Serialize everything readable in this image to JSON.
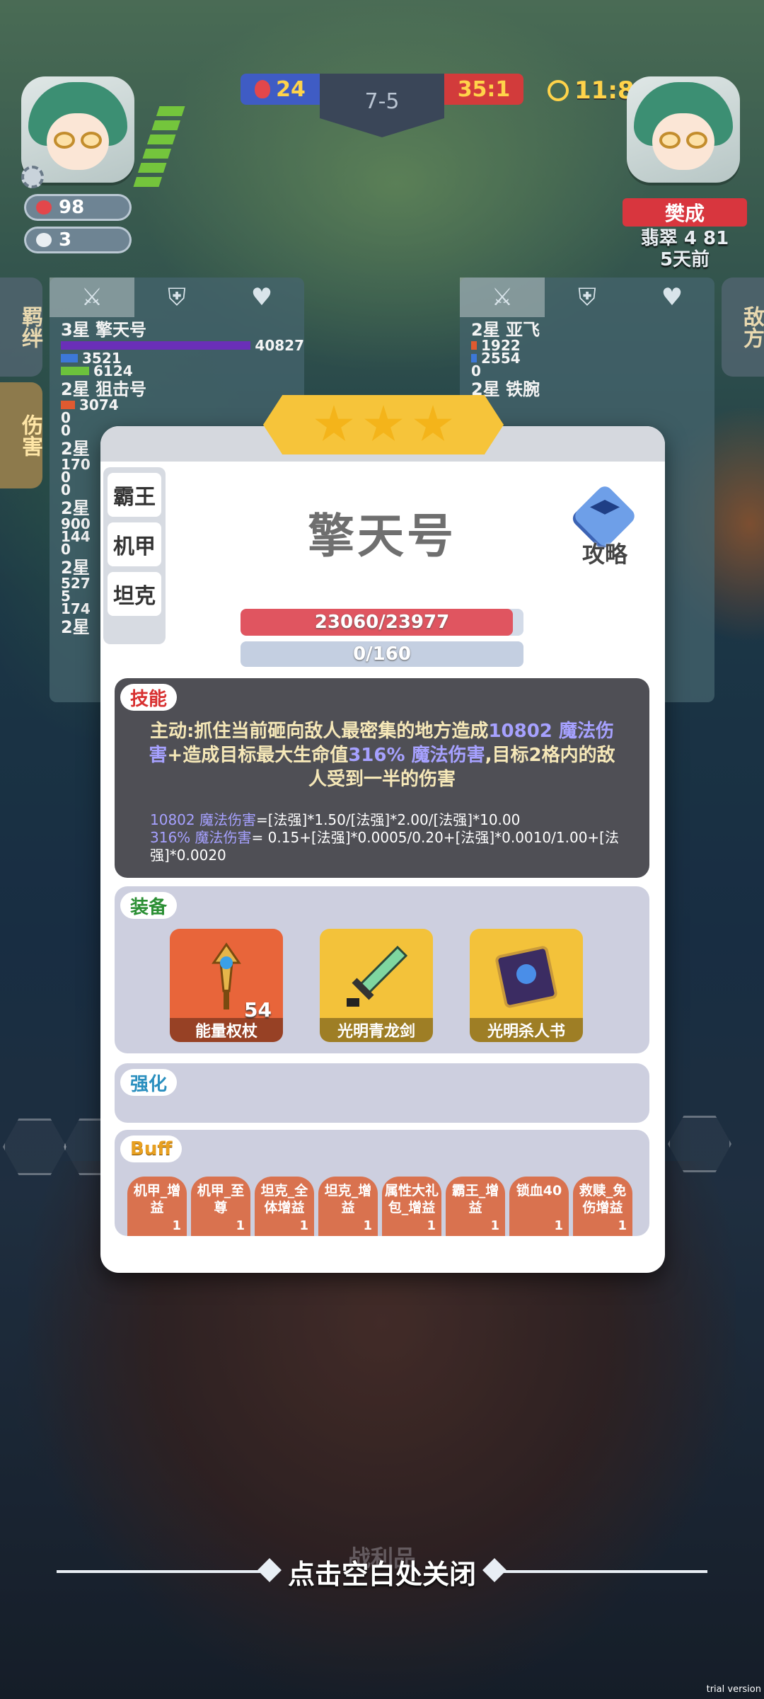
{
  "hud": {
    "player_hp": "98",
    "player_coins": "3",
    "kills_left": "24",
    "round": "7-5",
    "kills_right": "35:1",
    "timer": "11:8"
  },
  "enemy": {
    "name": "樊成",
    "rank": "翡翠 4 81",
    "time_ago": "5天前"
  },
  "left_panel": {
    "side_tabs": [
      "羁绊",
      "伤害"
    ],
    "rows": [
      {
        "name": "3星 擎天号",
        "values": [
          "40827",
          "3521",
          "6124"
        ]
      },
      {
        "name": "2星 狙击号",
        "values": [
          "3074",
          "0",
          "0"
        ]
      },
      {
        "name": "2星",
        "values": [
          "170",
          "0",
          "0"
        ]
      },
      {
        "name": "2星",
        "values": [
          "900",
          "144",
          "0"
        ]
      },
      {
        "name": "2星",
        "values": [
          "527",
          "5",
          "174"
        ]
      },
      {
        "name": "2星",
        "values": []
      }
    ]
  },
  "right_panel": {
    "side_tab": "敌方",
    "rows": [
      {
        "name": "2星 亚飞",
        "values": [
          "1922",
          "2554",
          "0"
        ]
      },
      {
        "name": "2星 铁腕",
        "values": []
      }
    ]
  },
  "modal": {
    "stars": 3,
    "traits": [
      "霸王",
      "机甲",
      "坦克"
    ],
    "unit_name": "擎天号",
    "guide_label": "攻略",
    "hp_text": "23060/23977",
    "hp_fraction": 0.962,
    "mp_text": "0/160",
    "skill": {
      "tag": "技能",
      "desc_1": "主动:抓住当前砸向敌人最密集的地方造成",
      "desc_hl_1": "10802 魔法伤害",
      "desc_2": "+造成目标最大生命值",
      "desc_hl_2": "316% 魔法伤害",
      "desc_3": ",目标2格内的敌人受到一半的伤害",
      "formula_1_hl": "10802 魔法伤害",
      "formula_1": "=[法强]*1.50/[法强]*2.00/[法强]*10.00",
      "formula_2_hl": "316% 魔法伤害",
      "formula_2": "= 0.15+[法强]*0.0005/0.20+[法强]*0.0010/1.00+[法强]*0.0020"
    },
    "equip": {
      "tag": "装备",
      "items": [
        {
          "name": "能量权杖",
          "count": "54",
          "icon": "scepter-icon"
        },
        {
          "name": "光明青龙剑",
          "icon": "sword-icon"
        },
        {
          "name": "光明杀人书",
          "icon": "book-icon"
        }
      ]
    },
    "enhance": {
      "tag": "强化"
    },
    "buff": {
      "tag": "Buff",
      "items": [
        {
          "name": "机甲_增益",
          "count": "1"
        },
        {
          "name": "机甲_至尊",
          "count": "1"
        },
        {
          "name": "坦克_全体增益",
          "count": "1"
        },
        {
          "name": "坦克_增益",
          "count": "1"
        },
        {
          "name": "属性大礼包_增益",
          "count": "1"
        },
        {
          "name": "霸王_增益",
          "count": "1"
        },
        {
          "name": "锁血40",
          "count": "1"
        },
        {
          "name": "救赎_免伤增益",
          "count": "1"
        }
      ]
    }
  },
  "footer": {
    "close_hint": "点击空白处关闭",
    "ghost_label": "战利品",
    "watermark": "trial version"
  }
}
